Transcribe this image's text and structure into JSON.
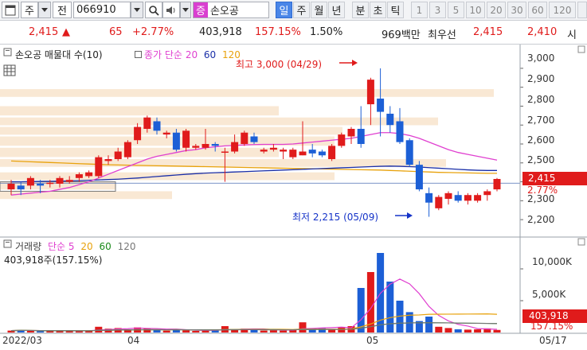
{
  "toolbar": {
    "type_label": "주",
    "jeon_label": "전",
    "code": "066910",
    "name_badge": "증",
    "name": "손오공",
    "periods": [
      "일",
      "주",
      "월",
      "년",
      "분",
      "초",
      "틱"
    ],
    "active_period": "일",
    "intervals": [
      "1",
      "3",
      "5",
      "10",
      "20",
      "30",
      "60",
      "120"
    ]
  },
  "quote": {
    "price": "2,415",
    "change_arrow": "▲",
    "change": "65",
    "change_pct": "+2.77%",
    "volume": "403,918",
    "volume_ratio": "157.15%",
    "turnover": "1.50%",
    "amount": "969백만",
    "bid_label": "최우선",
    "bid1": "2,415",
    "bid2": "2,410",
    "extra": "시"
  },
  "price_chart": {
    "legend_title": "손오공 매물대 수(10)",
    "legend_ma_label": "종가 단순",
    "ma_periods": [
      "20",
      "60",
      "120"
    ],
    "ma_colors": [
      "#e040d0",
      "#1a2fa8",
      "#e8a20c"
    ],
    "high_annotation": "최고 3,000 (04/29)",
    "low_annotation": "최저 2,215 (05/09)",
    "y_ticks": [
      "3,000",
      "2,900",
      "2,800",
      "2,700",
      "2,600",
      "2,500",
      "2,400",
      "2,300",
      "2,200"
    ],
    "current_price": "2,415",
    "current_change": "2.77%"
  },
  "volume_chart": {
    "legend_name": "거래량",
    "legend_ma_label": "단순",
    "ma_periods": [
      "5",
      "20",
      "60",
      "120"
    ],
    "ma_colors": [
      "#e040d0",
      "#e8a20c",
      "#1a8a1a",
      "#777"
    ],
    "volume_text": "403,918주(157.15%)",
    "y_ticks": [
      "10,000K",
      "5,000K"
    ],
    "current_volume": "403,918",
    "current_ratio": "157.15%"
  },
  "x_ticks": [
    "2022/03",
    "04",
    "05",
    "05/17"
  ],
  "chart_data": {
    "type": "candlestick",
    "price_range": [
      2150,
      3050
    ],
    "candles": [
      {
        "o": 2360,
        "c": 2390,
        "h": 2410,
        "l": 2330
      },
      {
        "o": 2380,
        "c": 2360,
        "h": 2400,
        "l": 2330
      },
      {
        "o": 2380,
        "c": 2420,
        "h": 2430,
        "l": 2360
      },
      {
        "o": 2390,
        "c": 2380,
        "h": 2410,
        "l": 2340
      },
      {
        "o": 2390,
        "c": 2395,
        "h": 2410,
        "l": 2370
      },
      {
        "o": 2390,
        "c": 2420,
        "h": 2430,
        "l": 2370
      },
      {
        "o": 2400,
        "c": 2410,
        "h": 2430,
        "l": 2390
      },
      {
        "o": 2420,
        "c": 2440,
        "h": 2450,
        "l": 2400
      },
      {
        "o": 2430,
        "c": 2450,
        "h": 2460,
        "l": 2420
      },
      {
        "o": 2430,
        "c": 2530,
        "h": 2540,
        "l": 2420
      },
      {
        "o": 2510,
        "c": 2520,
        "h": 2540,
        "l": 2490
      },
      {
        "o": 2520,
        "c": 2560,
        "h": 2580,
        "l": 2510
      },
      {
        "o": 2530,
        "c": 2610,
        "h": 2620,
        "l": 2520
      },
      {
        "o": 2620,
        "c": 2690,
        "h": 2710,
        "l": 2600
      },
      {
        "o": 2680,
        "c": 2740,
        "h": 2750,
        "l": 2660
      },
      {
        "o": 2720,
        "c": 2670,
        "h": 2740,
        "l": 2650
      },
      {
        "o": 2650,
        "c": 2660,
        "h": 2670,
        "l": 2630
      },
      {
        "o": 2660,
        "c": 2570,
        "h": 2680,
        "l": 2560
      },
      {
        "o": 2580,
        "c": 2670,
        "h": 2680,
        "l": 2560
      },
      {
        "o": 2580,
        "c": 2590,
        "h": 2600,
        "l": 2570
      },
      {
        "o": 2580,
        "c": 2600,
        "h": 2680,
        "l": 2570
      },
      {
        "o": 2600,
        "c": 2590,
        "h": 2610,
        "l": 2560
      },
      {
        "o": 2560,
        "c": 2560,
        "h": 2580,
        "l": 2400
      },
      {
        "o": 2560,
        "c": 2610,
        "h": 2650,
        "l": 2550
      },
      {
        "o": 2600,
        "c": 2660,
        "h": 2670,
        "l": 2590
      },
      {
        "o": 2640,
        "c": 2610,
        "h": 2660,
        "l": 2600
      },
      {
        "o": 2560,
        "c": 2570,
        "h": 2580,
        "l": 2550
      },
      {
        "o": 2570,
        "c": 2580,
        "h": 2600,
        "l": 2560
      },
      {
        "o": 2560,
        "c": 2570,
        "h": 2580,
        "l": 2520
      },
      {
        "o": 2530,
        "c": 2570,
        "h": 2580,
        "l": 2520
      },
      {
        "o": 2540,
        "c": 2560,
        "h": 2720,
        "l": 2540
      },
      {
        "o": 2570,
        "c": 2550,
        "h": 2600,
        "l": 2530
      },
      {
        "o": 2560,
        "c": 2540,
        "h": 2570,
        "l": 2530
      },
      {
        "o": 2520,
        "c": 2590,
        "h": 2600,
        "l": 2510
      },
      {
        "o": 2590,
        "c": 2650,
        "h": 2660,
        "l": 2580
      },
      {
        "o": 2640,
        "c": 2680,
        "h": 2690,
        "l": 2600
      },
      {
        "o": 2680,
        "c": 2600,
        "h": 2800,
        "l": 2580
      },
      {
        "o": 2810,
        "c": 2940,
        "h": 2950,
        "l": 2700
      },
      {
        "o": 2840,
        "c": 2770,
        "h": 3000,
        "l": 2640
      },
      {
        "o": 2760,
        "c": 2700,
        "h": 2800,
        "l": 2660
      },
      {
        "o": 2720,
        "c": 2610,
        "h": 2790,
        "l": 2600
      },
      {
        "o": 2620,
        "c": 2490,
        "h": 2630,
        "l": 2480
      },
      {
        "o": 2490,
        "c": 2360,
        "h": 2510,
        "l": 2350
      },
      {
        "o": 2340,
        "c": 2290,
        "h": 2370,
        "l": 2215
      },
      {
        "o": 2260,
        "c": 2320,
        "h": 2330,
        "l": 2250
      },
      {
        "o": 2310,
        "c": 2340,
        "h": 2350,
        "l": 2280
      },
      {
        "o": 2330,
        "c": 2300,
        "h": 2350,
        "l": 2290
      },
      {
        "o": 2300,
        "c": 2330,
        "h": 2340,
        "l": 2280
      },
      {
        "o": 2300,
        "c": 2330,
        "h": 2340,
        "l": 2290
      },
      {
        "o": 2330,
        "c": 2350,
        "h": 2360,
        "l": 2300
      },
      {
        "o": 2360,
        "c": 2415,
        "h": 2420,
        "l": 2350
      }
    ],
    "volume_range": [
      0,
      13000
    ],
    "volumes": [
      300,
      350,
      320,
      200,
      220,
      300,
      250,
      260,
      280,
      900,
      600,
      700,
      500,
      800,
      650,
      400,
      300,
      500,
      350,
      250,
      300,
      300,
      1000,
      450,
      600,
      500,
      300,
      350,
      300,
      400,
      1600,
      600,
      700,
      550,
      800,
      1000,
      7000,
      9500,
      12500,
      8000,
      5000,
      3200,
      1800,
      2500,
      900,
      700,
      500,
      450,
      500,
      650,
      404
    ],
    "ma20": [
      2330,
      2335,
      2340,
      2345,
      2350,
      2360,
      2370,
      2385,
      2400,
      2420,
      2440,
      2460,
      2480,
      2500,
      2520,
      2535,
      2545,
      2555,
      2565,
      2570,
      2580,
      2585,
      2590,
      2592,
      2595,
      2597,
      2598,
      2598,
      2598,
      2600,
      2605,
      2610,
      2615,
      2620,
      2625,
      2630,
      2640,
      2650,
      2660,
      2660,
      2655,
      2645,
      2630,
      2610,
      2590,
      2570,
      2555,
      2545,
      2535,
      2525,
      2515
    ],
    "ma60": [
      2400,
      2400,
      2401,
      2402,
      2403,
      2404,
      2405,
      2406,
      2408,
      2410,
      2412,
      2414,
      2417,
      2420,
      2424,
      2428,
      2432,
      2436,
      2440,
      2443,
      2446,
      2448,
      2450,
      2452,
      2454,
      2456,
      2458,
      2460,
      2462,
      2464,
      2466,
      2468,
      2470,
      2472,
      2474,
      2476,
      2478,
      2480,
      2482,
      2483,
      2482,
      2480,
      2478,
      2475,
      2472,
      2469,
      2466,
      2463,
      2461,
      2460,
      2460
    ],
    "ma120": [
      2510,
      2508,
      2506,
      2504,
      2502,
      2500,
      2498,
      2496,
      2494,
      2492,
      2490,
      2489,
      2488,
      2487,
      2486,
      2485,
      2484,
      2483,
      2482,
      2481,
      2480,
      2479,
      2478,
      2477,
      2476,
      2475,
      2474,
      2473,
      2472,
      2471,
      2470,
      2469,
      2468,
      2467,
      2466,
      2465,
      2464,
      2463,
      2462,
      2460,
      2458,
      2456,
      2454,
      2452,
      2450,
      2449,
      2448,
      2447,
      2446,
      2445,
      2445
    ],
    "volume_profile": [
      {
        "lo": 2840,
        "hi": 2890,
        "w": 620
      },
      {
        "lo": 2740,
        "hi": 2800,
        "w": 350
      },
      {
        "lo": 2690,
        "hi": 2740,
        "w": 550
      },
      {
        "lo": 2640,
        "hi": 2690,
        "w": 430
      },
      {
        "lo": 2580,
        "hi": 2640,
        "w": 420
      },
      {
        "lo": 2520,
        "hi": 2580,
        "w": 350
      },
      {
        "lo": 2470,
        "hi": 2520,
        "w": 560
      },
      {
        "lo": 2400,
        "hi": 2450,
        "w": 420
      },
      {
        "lo": 2350,
        "hi": 2400,
        "w": 145
      },
      {
        "lo": 2300,
        "hi": 2350,
        "w": 216
      }
    ]
  }
}
